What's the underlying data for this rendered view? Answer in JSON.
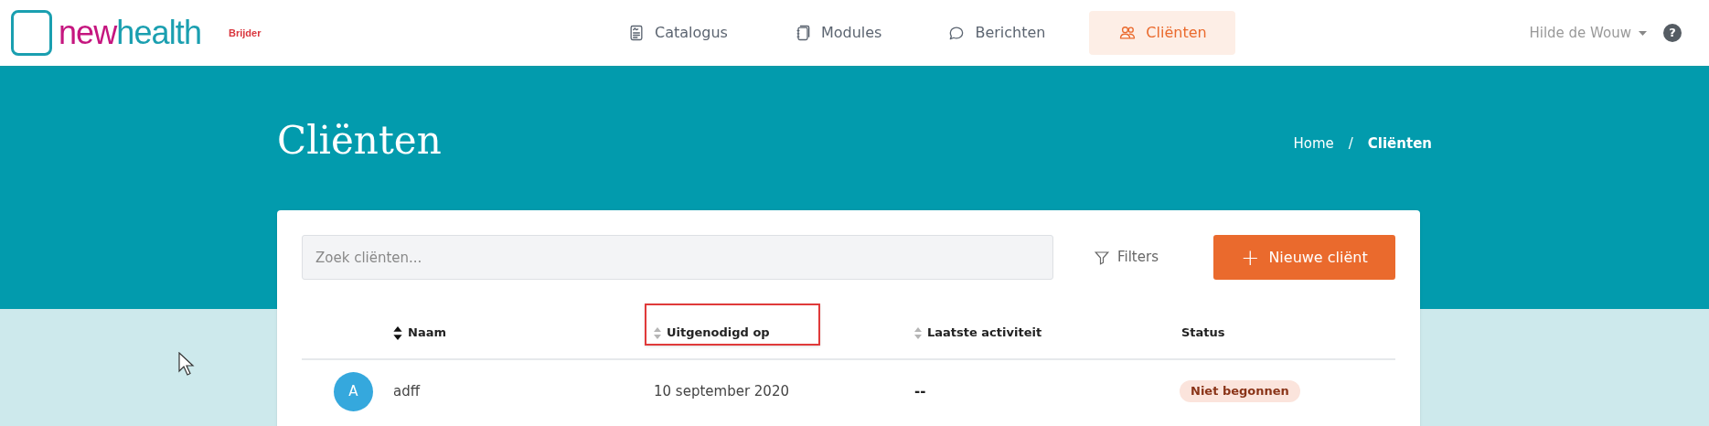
{
  "logo": {
    "part_1": "new",
    "part_2": "health"
  },
  "partner_logo": {
    "text": "Brijder"
  },
  "nav": [
    {
      "label": "Catalogus",
      "kind": "catalog",
      "selected": false
    },
    {
      "label": "Modules",
      "kind": "modules",
      "selected": false
    },
    {
      "label": "Berichten",
      "kind": "chat",
      "selected": false
    },
    {
      "label": "Cliënten",
      "kind": "users",
      "selected": true
    }
  ],
  "user_menu": {
    "name": "Hilde de Wouw"
  },
  "help": {
    "label": "?"
  },
  "page_title": "Cliënten",
  "breadcrumb": [
    {
      "label": "Home",
      "current": false
    },
    {
      "label": "Cliënten",
      "current": true
    }
  ],
  "breadcrumb_separator": "/",
  "search": {
    "placeholder": "Zoek cliënten..."
  },
  "filters_button": "Filters",
  "new_button": {
    "icon": "+",
    "label": "Nieuwe cliënt"
  },
  "table": {
    "columns": [
      {
        "label": "Naam",
        "sortable": true,
        "sorted": true,
        "highlighted": false
      },
      {
        "label": "Uitgenodigd op",
        "sortable": true,
        "sorted": false,
        "highlighted": true
      },
      {
        "label": "Laatste activiteit",
        "sortable": true,
        "sorted": false,
        "highlighted": false
      },
      {
        "label": "Status",
        "sortable": false,
        "highlighted": false
      }
    ],
    "rows": [
      {
        "initial": "A",
        "name": "adff",
        "invited": "10 september 2020",
        "last_activity": "--",
        "status": "Niet begonnen"
      }
    ]
  }
}
